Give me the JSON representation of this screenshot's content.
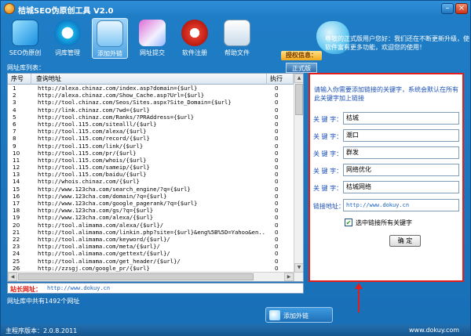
{
  "window": {
    "title": "桔城SEO伪原创工具 V2.0",
    "minimize": "–",
    "close": "×"
  },
  "toolbar": {
    "items": [
      {
        "label": "SEO伪原创",
        "icon": "document-icon"
      },
      {
        "label": "词库管理",
        "icon": "disc-icon"
      },
      {
        "label": "添加外链",
        "icon": "monitor-icon"
      },
      {
        "label": "网址提交",
        "icon": "pen-icon"
      },
      {
        "label": "软件注册",
        "icon": "chrome-icon"
      },
      {
        "label": "帮助文件",
        "icon": "help-doc-icon"
      }
    ],
    "active_index": 2
  },
  "auth": {
    "title": "授权信息：",
    "version": "正式版"
  },
  "notice": "尊敬的正式版用户您好：我们还在不断更新升级，使软件富有更多功能，欢迎您的使用！",
  "list": {
    "label": "网址库列表：",
    "columns": {
      "no": "序号",
      "url": "查询地址",
      "exec": "执行"
    },
    "rows": [
      {
        "no": "1",
        "url": "http://alexa.chinaz.com/index.asp?domain={$url}",
        "exec": "0"
      },
      {
        "no": "2",
        "url": "http://alexa.chinaz.com/Show_Cache.asp?Url={$url}",
        "exec": "0"
      },
      {
        "no": "3",
        "url": "http://tool.chinaz.com/Seos/Sites.aspx?Site_Domain={$url}",
        "exec": "0"
      },
      {
        "no": "4",
        "url": "http://link.chinaz.com/?wd={$url}",
        "exec": "0"
      },
      {
        "no": "5",
        "url": "http://tool.chinaz.com/Ranks/?PRAddress={$url}",
        "exec": "0"
      },
      {
        "no": "6",
        "url": "http://tool.115.com/sitealll/{$url}",
        "exec": "0"
      },
      {
        "no": "7",
        "url": "http://tool.115.com/alexa/{$url}",
        "exec": "0"
      },
      {
        "no": "8",
        "url": "http://tool.115.com/record/{$url}",
        "exec": "0"
      },
      {
        "no": "9",
        "url": "http://tool.115.com/link/{$url}",
        "exec": "0"
      },
      {
        "no": "10",
        "url": "http://tool.115.com/pr/{$url}",
        "exec": "0"
      },
      {
        "no": "11",
        "url": "http://tool.115.com/whois/{$url}",
        "exec": "0"
      },
      {
        "no": "12",
        "url": "http://tool.115.com/sameip/{$url}",
        "exec": "0"
      },
      {
        "no": "13",
        "url": "http://tool.115.com/baidu/{$url}",
        "exec": "0"
      },
      {
        "no": "14",
        "url": "http://whois.chinaz.com/{$url}",
        "exec": "0"
      },
      {
        "no": "15",
        "url": "http://www.123cha.com/search_engine/?q={$url}",
        "exec": "0"
      },
      {
        "no": "16",
        "url": "http://www.123cha.com/domain/?q={$url}",
        "exec": "0"
      },
      {
        "no": "17",
        "url": "http://www.123cha.com/google_pagerank/?q={$url}",
        "exec": "0"
      },
      {
        "no": "18",
        "url": "http://www.123cha.com/gs/?q={$url}",
        "exec": "0"
      },
      {
        "no": "19",
        "url": "http://www.123cha.com/alexa/{$url}",
        "exec": "0"
      },
      {
        "no": "20",
        "url": "http://tool.alimama.com/alexa/{$url}/",
        "exec": "0"
      },
      {
        "no": "21",
        "url": "http://tool.alimama.com/linkin.php?site={$url}&eng%5B%5D=Yahoo&en...",
        "exec": "0"
      },
      {
        "no": "22",
        "url": "http://tool.alimama.com/keyword/{$url}/",
        "exec": "0"
      },
      {
        "no": "23",
        "url": "http://tool.alimama.com/meta/{$url}/",
        "exec": "0"
      },
      {
        "no": "24",
        "url": "http://tool.alimama.com/gettext/{$url}/",
        "exec": "0"
      },
      {
        "no": "25",
        "url": "http://tool.alimama.com/get_header/{$url}/",
        "exec": "0"
      },
      {
        "no": "26",
        "url": "http://zzsgj.com/google_pr/{$url}",
        "exec": "0"
      },
      {
        "no": "27",
        "url": "http://tool.alimama.com/code/{$url}/",
        "exec": "0"
      }
    ]
  },
  "site": {
    "label": "站长网址：",
    "value": "http://www.dokuy.cn"
  },
  "count_text": "网址库中共有1492个网址",
  "form": {
    "hint": "请输入你需要添加链接的关键字，系统会默认在所有此关键字加上链接",
    "keyword_label": "关 键 字：",
    "keywords": [
      "桔城",
      "潮口",
      "群发",
      "网络优化",
      "桔城网络"
    ],
    "link_label": "链接地址：",
    "link_value": "http://www.dokuy.cn",
    "checkbox_label": "选中链接所有关键字",
    "checkbox_mark": "✔",
    "ok_label": "确 定"
  },
  "add_link_button": "添加外链",
  "footer": {
    "version": "主程序版本：2.0.8.2011",
    "site": "www.dokuy.com"
  },
  "colors": {
    "accent_red": "#e31c1c",
    "link_blue": "#1660c0",
    "window_blue": "#1f7dc6"
  }
}
